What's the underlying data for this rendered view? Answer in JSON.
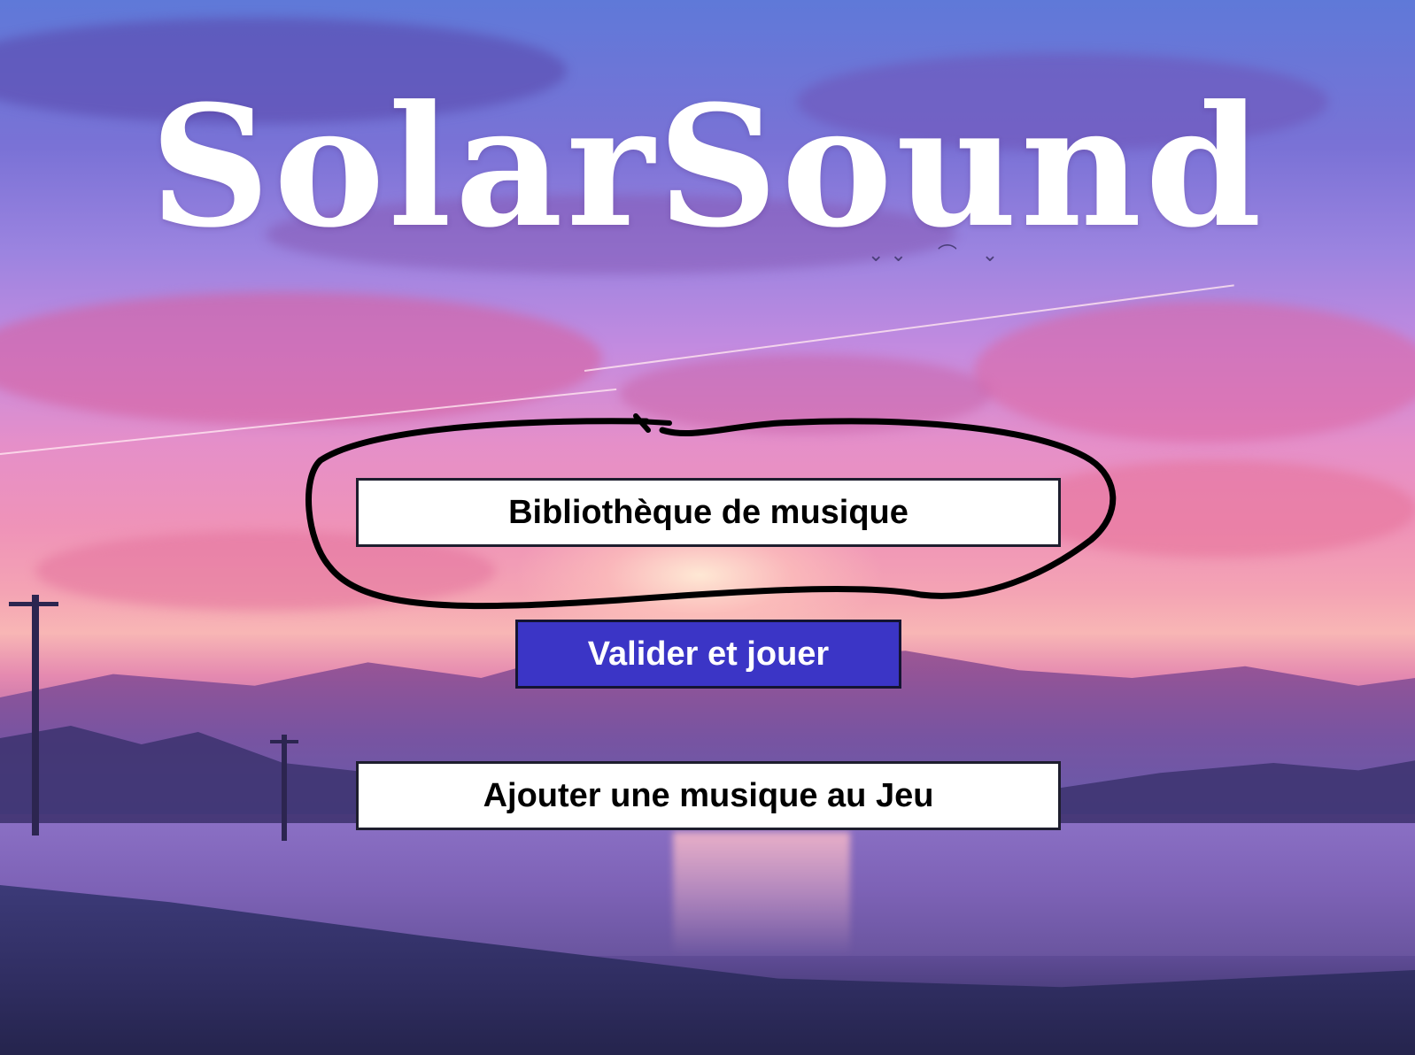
{
  "title": "SolarSound",
  "menu": {
    "library_button": "Bibliothèque de musique",
    "play_button": "Valider et jouer",
    "add_music_button": "Ajouter une musique au Jeu"
  },
  "colors": {
    "play_button_bg": "#3b35c6",
    "secondary_button_bg": "#ffffff",
    "annotation_stroke": "#000000"
  }
}
